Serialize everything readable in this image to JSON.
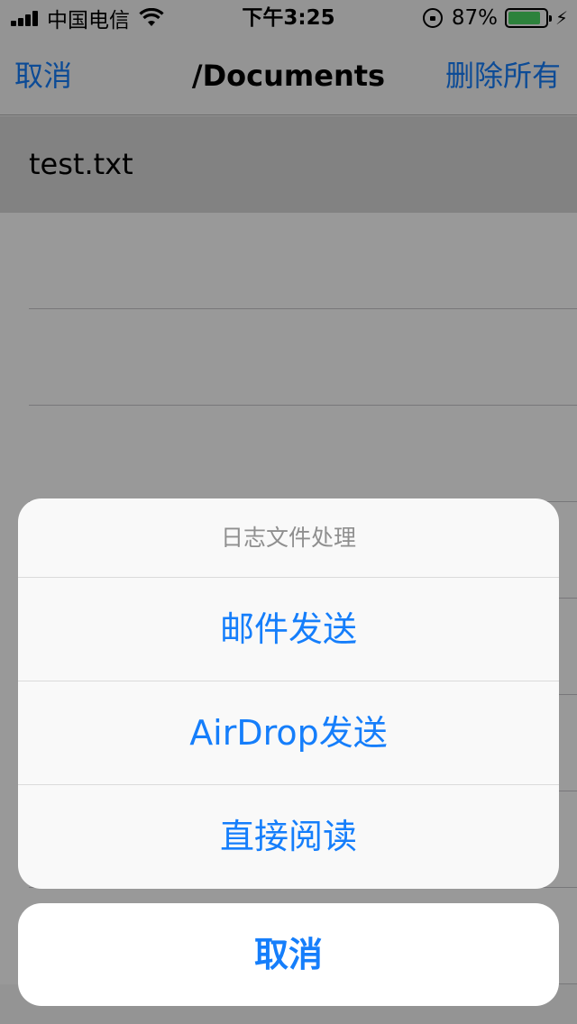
{
  "status_bar": {
    "carrier": "中国电信",
    "time": "下午3:25",
    "battery_percent": "87%",
    "battery_level": 0.87,
    "battery_color": "#4cd964",
    "icons": [
      "signal-icon",
      "wifi-icon",
      "orientation-lock-icon",
      "battery-icon",
      "charging-bolt-icon"
    ]
  },
  "nav": {
    "left_label": "取消",
    "title": "/Documents",
    "right_label": "删除所有"
  },
  "files": [
    {
      "name": "test.txt",
      "selected": true
    },
    {
      "name": ""
    },
    {
      "name": ""
    },
    {
      "name": ""
    },
    {
      "name": ""
    },
    {
      "name": ""
    },
    {
      "name": ""
    },
    {
      "name": ""
    },
    {
      "name": ""
    }
  ],
  "action_sheet": {
    "title": "日志文件处理",
    "actions": [
      "邮件发送",
      "AirDrop发送",
      "直接阅读"
    ],
    "cancel_label": "取消"
  },
  "colors": {
    "accent": "#157efb",
    "overlay": "rgba(0,0,0,0.40)"
  }
}
